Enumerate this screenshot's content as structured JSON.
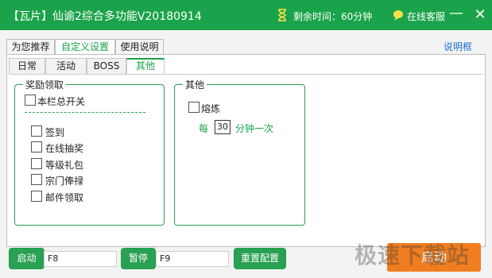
{
  "window": {
    "title": "【瓦片】仙谕2综合多功能V20180914",
    "timer": "剩余时间：60分钟",
    "service": "在线客服",
    "minimize": "—",
    "close": "✕"
  },
  "top_tabs": [
    "为您推荐",
    "自定义设置",
    "使用说明"
  ],
  "help_link": "说明框",
  "inner_tabs": [
    "日常",
    "活动",
    "BOSS",
    "其他"
  ],
  "rewards_group": {
    "title": "奖励领取",
    "master_switch": "本栏总开关",
    "items": [
      "签到",
      "在线抽奖",
      "等级礼包",
      "宗门俸禄",
      "邮件领取"
    ]
  },
  "other_group": {
    "title": "其他",
    "smelt_label": "熔炼",
    "every_prefix": "每",
    "minutes_value": "30",
    "every_suffix": "分钟一次"
  },
  "bottom": {
    "start_label": "启动",
    "start_key": "F8",
    "pause_label": "暂停",
    "pause_key": "F9",
    "reset_label": "重置配置",
    "launch_label": "启动"
  },
  "watermark": "极速下载站",
  "colors": {
    "accent": "#1aa34a",
    "button_orange": "#f07d1f",
    "link": "#1f6fd1"
  }
}
